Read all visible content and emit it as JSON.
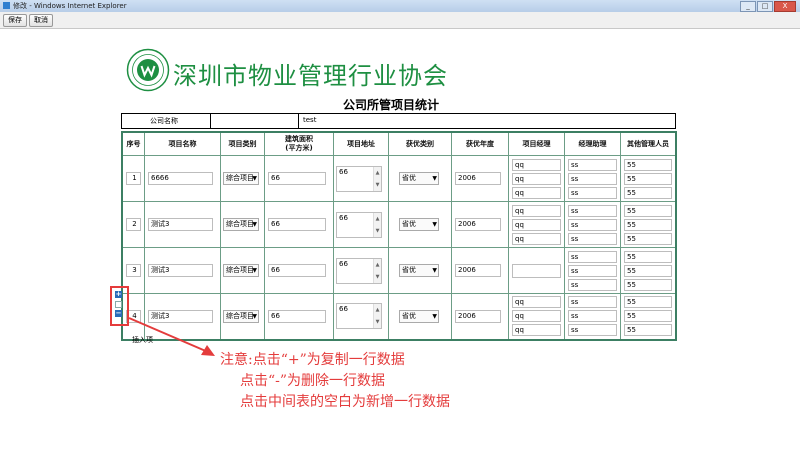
{
  "window": {
    "title": "修改 - Windows Internet Explorer",
    "min": "_",
    "max": "□",
    "close": "X"
  },
  "toolbar": {
    "save_label": "保存",
    "cancel_label": "取消"
  },
  "header": {
    "org_name": "深圳市物业管理行业协会",
    "page_title": "公司所管项目统计"
  },
  "company": {
    "label": "公司名称",
    "value": "test"
  },
  "columns": [
    "序号",
    "项目名称",
    "项目类别",
    "建筑面积\n(平方米)",
    "项目地址",
    "获优类别",
    "获优年度",
    "项目经理",
    "经理助理",
    "其他管理人员"
  ],
  "rows": [
    {
      "no": "1",
      "name": "6666",
      "category": "综合项目",
      "area": "66",
      "address": "66",
      "award": "省优",
      "year": "2006",
      "managers": [
        "qq",
        "qq",
        "qq"
      ],
      "assistants": [
        "ss",
        "ss",
        "ss"
      ],
      "others": [
        "55",
        "55",
        "55"
      ]
    },
    {
      "no": "2",
      "name": "测试3",
      "category": "综合项目",
      "area": "66",
      "address": "66",
      "award": "省优",
      "year": "2006",
      "managers": [
        "qq",
        "qq",
        "qq"
      ],
      "assistants": [
        "ss",
        "ss",
        "ss"
      ],
      "others": [
        "55",
        "55",
        "55"
      ]
    },
    {
      "no": "3",
      "name": "测试3",
      "category": "综合项目",
      "area": "66",
      "address": "66",
      "award": "省优",
      "year": "2006",
      "managers": [
        ""
      ],
      "assistants": [
        "ss",
        "ss",
        "ss"
      ],
      "others": [
        "55",
        "55",
        "55"
      ]
    },
    {
      "no": "4",
      "name": "测试3",
      "category": "综合项目",
      "area": "66",
      "address": "66",
      "award": "省优",
      "year": "2006",
      "managers": [
        "qq",
        "qq",
        "qq"
      ],
      "assistants": [
        "ss",
        "ss",
        "ss"
      ],
      "others": [
        "55",
        "55",
        "55"
      ]
    }
  ],
  "controls": {
    "plus": "+",
    "minus": "−",
    "insert_label": "插入项"
  },
  "notes": {
    "line1": "注意:点击“+”为复制一行数据",
    "line2": "点击“-”为删除一行数据",
    "line3": "点击中间表的空白为新增一行数据"
  },
  "colors": {
    "accent_green": "#1e8f42",
    "border_green": "#3c7f63",
    "annotation_red": "#e43c3c",
    "control_blue": "#2a6cb8"
  }
}
